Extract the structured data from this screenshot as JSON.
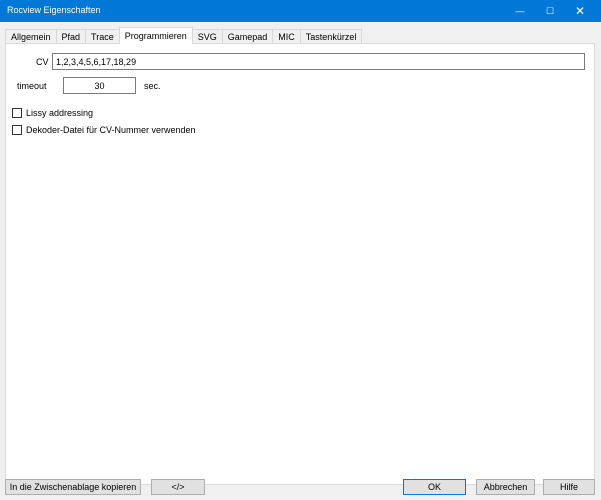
{
  "window": {
    "title": "Rocview Eigenschaften",
    "minimize_glyph": "—",
    "maximize_glyph": "☐",
    "close_glyph": "✕"
  },
  "tabs": [
    {
      "label": "Allgemein",
      "active": false
    },
    {
      "label": "Pfad",
      "active": false
    },
    {
      "label": "Trace",
      "active": false
    },
    {
      "label": "Programmieren",
      "active": true
    },
    {
      "label": "SVG",
      "active": false
    },
    {
      "label": "Gamepad",
      "active": false
    },
    {
      "label": "MIC",
      "active": false
    },
    {
      "label": "Tastenkürzel",
      "active": false
    }
  ],
  "programmieren": {
    "cv_label": "CV",
    "cv_value": "1,2,3,4,5,6,17,18,29",
    "timeout_label": "timeout",
    "timeout_value": "30",
    "timeout_unit": "sec.",
    "lissy_label": "Lissy addressing",
    "lissy_checked": false,
    "dekoder_label": "Dekoder-Datei für CV-Nummer verwenden",
    "dekoder_checked": false
  },
  "footer": {
    "copy_label": "In die Zwischenablage kopieren",
    "code_label": "</>",
    "ok_label": "OK",
    "cancel_label": "Abbrechen",
    "help_label": "Hilfe"
  }
}
